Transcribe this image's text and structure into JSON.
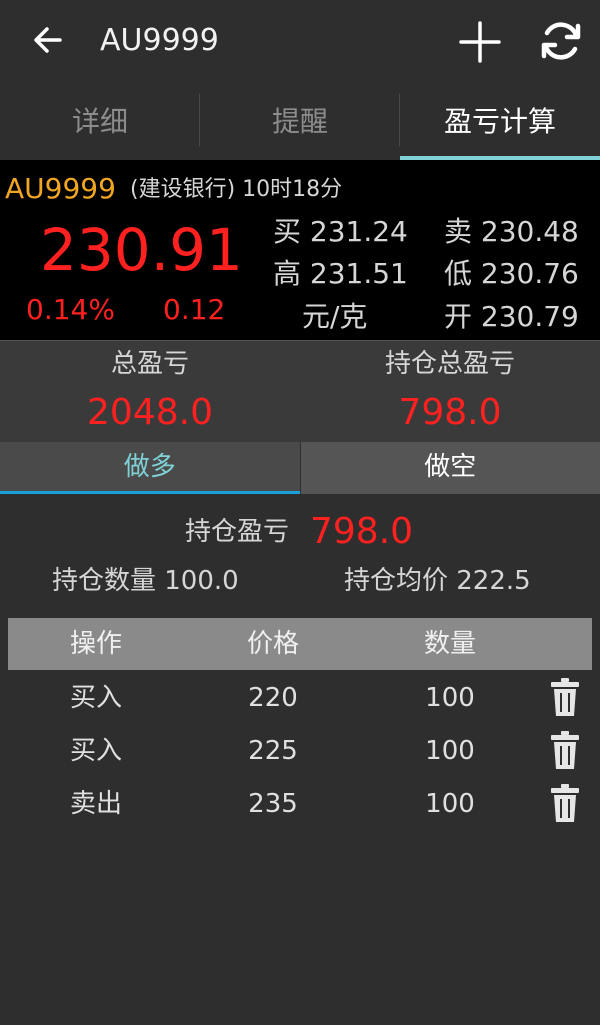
{
  "header": {
    "title": "AU9999"
  },
  "tabs": [
    {
      "label": "详细"
    },
    {
      "label": "提醒"
    },
    {
      "label": "盈亏计算"
    }
  ],
  "quote": {
    "symbol": "AU9999",
    "bank_time": "(建设银行) 10时18分",
    "price": "230.91",
    "change_pct": "0.14%",
    "change": "0.12",
    "buy": "买 231.24",
    "sell": "卖 230.48",
    "high": "高 231.51",
    "low": "低 230.76",
    "unit": "元/克",
    "open": "开 230.79"
  },
  "summary": {
    "total_label": "总盈亏",
    "total_value": "2048.0",
    "holding_total_label": "持仓总盈亏",
    "holding_total_value": "798.0"
  },
  "direction": {
    "long_label": "做多",
    "short_label": "做空"
  },
  "position": {
    "pl_label": "持仓盈亏",
    "pl_value": "798.0",
    "qty": "持仓数量 100.0",
    "avg_price": "持仓均价 222.5"
  },
  "table": {
    "headers": [
      "操作",
      "价格",
      "数量"
    ],
    "rows": [
      {
        "op": "买入",
        "price": "220",
        "qty": "100"
      },
      {
        "op": "买入",
        "price": "225",
        "qty": "100"
      },
      {
        "op": "卖出",
        "price": "235",
        "qty": "100"
      }
    ]
  },
  "colors": {
    "accent": "#7fd1d6",
    "up": "#ff2020",
    "symbol": "#f0a622",
    "indicator": "#1a9fd8"
  }
}
